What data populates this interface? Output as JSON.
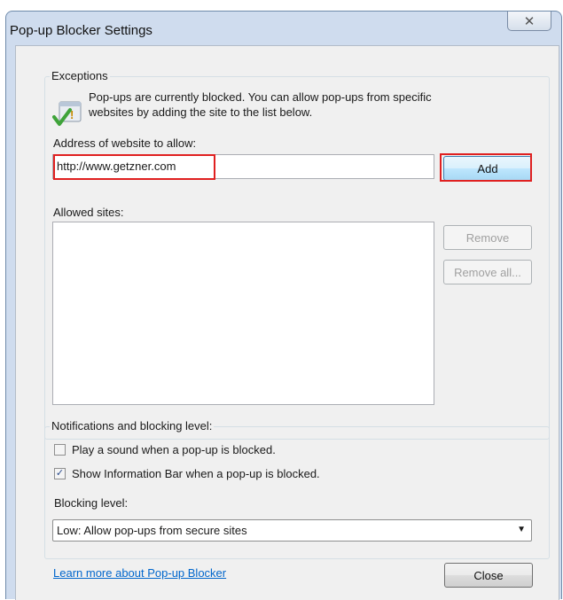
{
  "window": {
    "title": "Pop-up Blocker Settings",
    "close_glyph": "✕"
  },
  "exceptions": {
    "legend": "Exceptions",
    "info_line1": "Pop-ups are currently blocked.  You can allow pop-ups from specific",
    "info_line2": "websites by adding the site to the list below.",
    "address_label": "Address of website to allow:",
    "address_value": "http://www.getzner.com",
    "add_label": "Add",
    "allowed_label": "Allowed sites:",
    "remove_label": "Remove",
    "remove_all_label": "Remove all..."
  },
  "notifications": {
    "legend": "Notifications and blocking level:",
    "play_sound_label": "Play a sound when a pop-up is blocked.",
    "play_sound_checked": false,
    "info_bar_label": "Show Information Bar when a pop-up is blocked.",
    "info_bar_checked": true,
    "blocking_label": "Blocking level:",
    "blocking_value": "Low: Allow pop-ups from secure sites"
  },
  "footer": {
    "learn_more_label": "Learn more about Pop-up Blocker",
    "close_label": "Close"
  },
  "glyphs": {
    "check": "✓",
    "dropdown": "▼"
  },
  "colors": {
    "highlight": "#e02020",
    "link": "#0066cc",
    "default_button": "#bee6fd"
  }
}
